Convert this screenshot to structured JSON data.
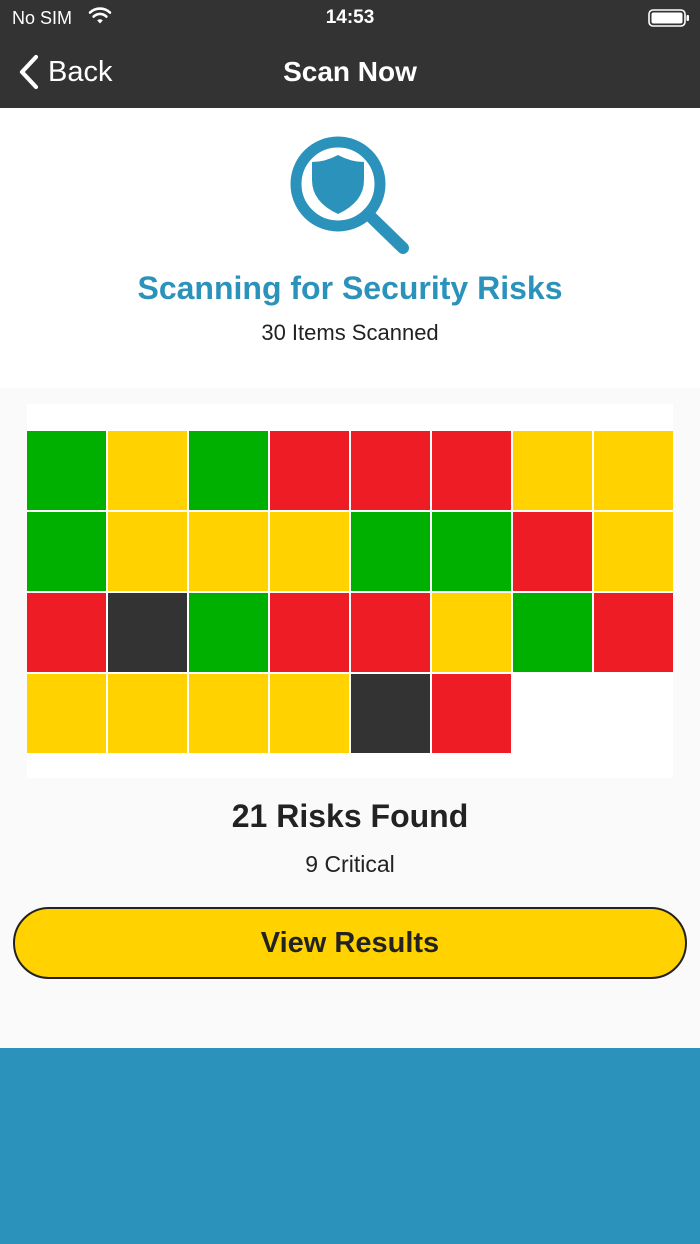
{
  "status_bar": {
    "carrier": "No SIM",
    "time": "14:53",
    "wifi_icon": "wifi-icon",
    "battery_icon": "battery-icon"
  },
  "nav": {
    "back_label": "Back",
    "title": "Scan Now",
    "back_icon": "chevron-left-icon"
  },
  "scan": {
    "icon": "magnifier-shield-icon",
    "title": "Scanning for Security Risks",
    "items_scanned": "30 Items Scanned"
  },
  "results": {
    "tiles": [
      "safe",
      "warning",
      "safe",
      "risk",
      "risk",
      "risk",
      "warning",
      "warning",
      "safe",
      "warning",
      "warning",
      "warning",
      "safe",
      "safe",
      "risk",
      "warning",
      "risk",
      "unknown",
      "safe",
      "risk",
      "risk",
      "warning",
      "safe",
      "risk",
      "warning",
      "warning",
      "warning",
      "warning",
      "unknown",
      "risk"
    ],
    "risks_found": "21 Risks Found",
    "critical": "9 Critical",
    "view_results_label": "View Results"
  },
  "colors": {
    "accent": "#2b93bb",
    "safe": "#00b000",
    "warning": "#ffd200",
    "risk": "#ee1c25",
    "unknown": "#333333",
    "nav_background": "#333333",
    "button": "#ffd200"
  }
}
